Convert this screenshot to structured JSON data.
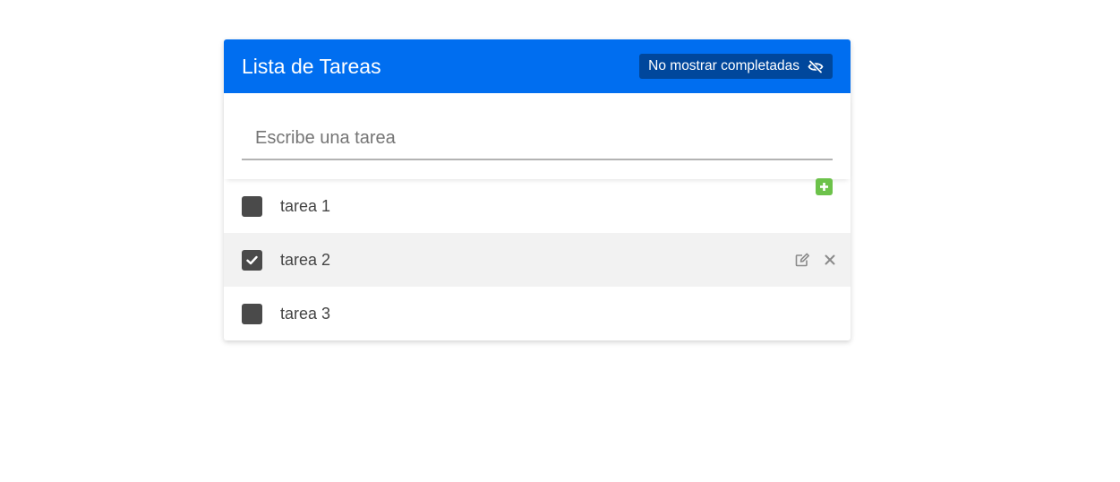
{
  "header": {
    "title": "Lista de Tareas",
    "toggle_label": "No mostrar completadas",
    "toggle_icon": "eye-slash-icon"
  },
  "input": {
    "placeholder": "Escribe una tarea",
    "value": "",
    "add_icon": "plus-square-icon"
  },
  "tasks": [
    {
      "label": "tarea 1",
      "completed": false
    },
    {
      "label": "tarea 2",
      "completed": true,
      "actions": [
        "edit-icon",
        "delete-icon"
      ]
    },
    {
      "label": "tarea 3",
      "completed": false
    }
  ],
  "colors": {
    "header_bg": "#006ef0",
    "toggle_bg": "#00479c",
    "add_button": "#6cc24a",
    "checkbox": "#4a4a4a"
  }
}
